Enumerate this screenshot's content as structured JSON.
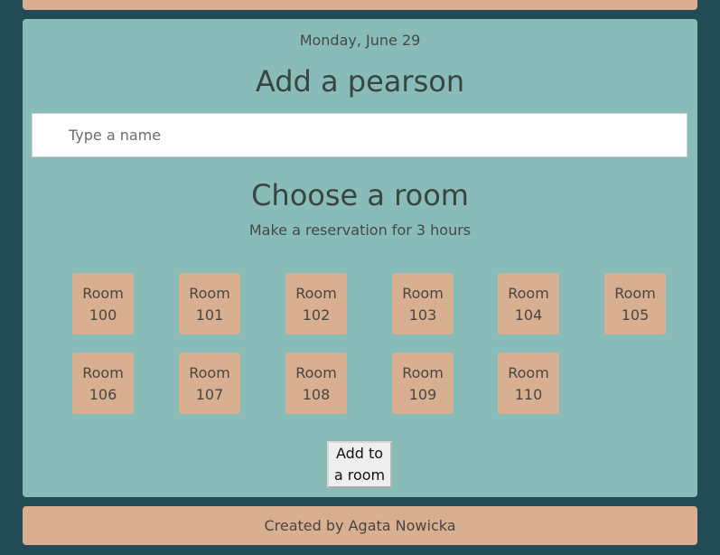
{
  "header": {
    "date": "Monday, June 29"
  },
  "add_person": {
    "title": "Add a pearson",
    "name_placeholder": "Type a name",
    "name_value": ""
  },
  "choose_room": {
    "title": "Choose a room",
    "subtitle": "Make a reservation for 3 hours"
  },
  "rooms": [
    {
      "word": "Room",
      "number": "100"
    },
    {
      "word": "Room",
      "number": "101"
    },
    {
      "word": "Room",
      "number": "102"
    },
    {
      "word": "Room",
      "number": "103"
    },
    {
      "word": "Room",
      "number": "104"
    },
    {
      "word": "Room",
      "number": "105"
    },
    {
      "word": "Room",
      "number": "106"
    },
    {
      "word": "Room",
      "number": "107"
    },
    {
      "word": "Room",
      "number": "108"
    },
    {
      "word": "Room",
      "number": "109"
    },
    {
      "word": "Room",
      "number": "110"
    }
  ],
  "actions": {
    "add_line1": "Add to",
    "add_line2": "a room"
  },
  "footer": {
    "credit": "Created by Agata Nowicka"
  },
  "colors": {
    "page_background": "#234b56",
    "card_background": "#89bbb9",
    "accent_tan": "#d8b091"
  }
}
